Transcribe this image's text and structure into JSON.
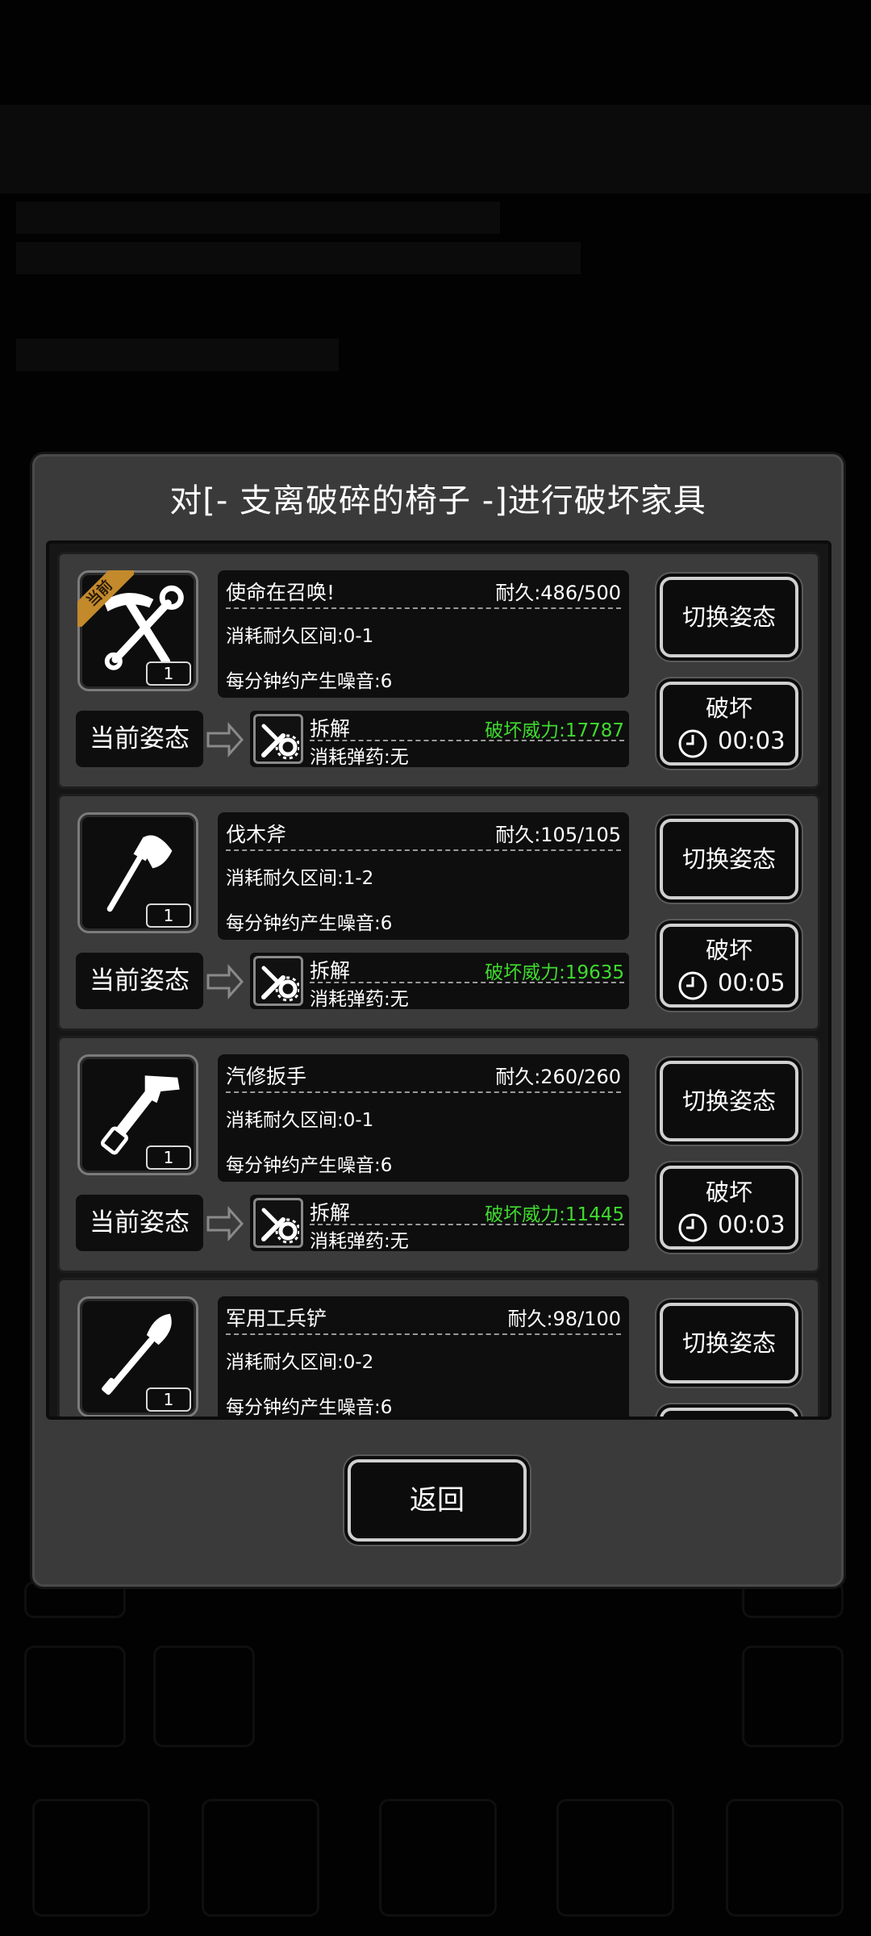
{
  "dialog": {
    "title": "对[- 支离破碎的椅子 -]进行破坏家具",
    "back_label": "返回"
  },
  "labels": {
    "switch_stance": "切换姿态",
    "break": "破坏",
    "current_stance": "当前姿态",
    "current_tag": "当前"
  },
  "tools": [
    {
      "name": "使命在召唤!",
      "durability": "耐久:486/500",
      "consume_range": "消耗耐久区间:0-1",
      "noise": "每分钟约产生噪音:6",
      "count": "1",
      "icon": "hammer-wrench-icon",
      "is_current": true,
      "stance": "拆解",
      "power": "破坏威力:17787",
      "ammo": "消耗弹药:无",
      "time": "00:03"
    },
    {
      "name": "伐木斧",
      "durability": "耐久:105/105",
      "consume_range": "消耗耐久区间:1-2",
      "noise": "每分钟约产生噪音:6",
      "count": "1",
      "icon": "axe-icon",
      "is_current": false,
      "stance": "拆解",
      "power": "破坏威力:19635",
      "ammo": "消耗弹药:无",
      "time": "00:05"
    },
    {
      "name": "汽修扳手",
      "durability": "耐久:260/260",
      "consume_range": "消耗耐久区间:0-1",
      "noise": "每分钟约产生噪音:6",
      "count": "1",
      "icon": "pipe-wrench-icon",
      "is_current": false,
      "stance": "拆解",
      "power": "破坏威力:11445",
      "ammo": "消耗弹药:无",
      "time": "00:03"
    },
    {
      "name": "军用工兵铲",
      "durability": "耐久:98/100",
      "consume_range": "消耗耐久区间:0-2",
      "noise": "每分钟约产生噪音:6",
      "count": "1",
      "icon": "shovel-icon",
      "is_current": false
    }
  ],
  "colors": {
    "dialog_bg": "#3a3a3a",
    "panel_bg": "#0e0e0e",
    "power_green": "#3fdb2f",
    "ribbon_gold": "#c38a2c"
  }
}
